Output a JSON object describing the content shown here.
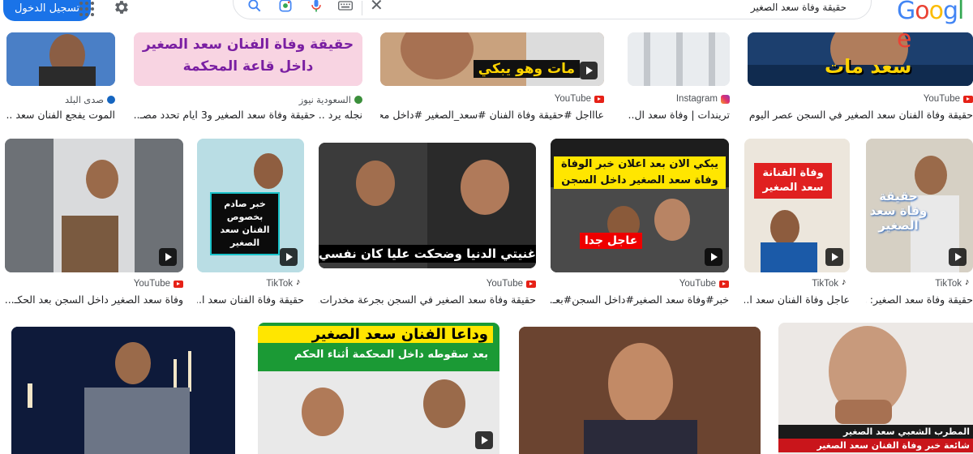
{
  "header": {
    "signin_label": "تسجيل الدخول",
    "search_query": "حقيقة وفاة سعد الصغير",
    "logo": [
      "G",
      "o",
      "o",
      "g",
      "l",
      "e"
    ],
    "logo_colors": [
      "#4285f4",
      "#ea4335",
      "#fbbc05",
      "#4285f4",
      "#34a853",
      "#ea4335"
    ]
  },
  "row1": [
    {
      "source": "YouTube",
      "title": "حقيقة وفاة الفنان سعد الصغير في السجن عصر اليوم ف...",
      "overlay": "سعد مات",
      "icon": "youtube-icon"
    },
    {
      "source": "Instagram",
      "title": "تريندات | وفاة سعد ال...",
      "overlay": "",
      "icon": "instagram-icon"
    },
    {
      "source": "YouTube",
      "title": "عاااجل #حقيقة وفاة الفنان #سعد_الصغير #داخل محب...",
      "overlay": "مات وهو يبكي",
      "icon": "youtube-icon"
    },
    {
      "source": "السعودية نيوز",
      "title": "نجله يرد .. حقيقة وفاة سعد الصغير و3 ايام تحدد مصـ...",
      "overlay": "حقيقة وفاة الفنان سعد الصغير داخل قاعة المحكمة",
      "icon": "site-icon"
    },
    {
      "source": "صدى البلد",
      "title": "الموت يفجع الفنان سعد ...",
      "overlay": "",
      "icon": "site-icon"
    }
  ],
  "row2": [
    {
      "source": "TikTok",
      "title": "حقيقة وفاة سعد الصغير: هل ...",
      "overlay": "حقيقة وفاة سعد الصغير",
      "icon": "tiktok-icon"
    },
    {
      "source": "TikTok",
      "title": "عاجل وفاة الفنان سعد ا...",
      "overlay": "وفاة الفنانة سعد الصغير",
      "icon": "tiktok-icon"
    },
    {
      "source": "YouTube",
      "title": "خبر#وفاة سعد الصغير#داخل السجن#بعـ...",
      "overlay": "يبكي الان بعد اعلان خبر الوفاة وفاة سعد الصغير داخل السجن",
      "overlay2": "عاجل جدا",
      "icon": "youtube-icon"
    },
    {
      "source": "YouTube",
      "title": "حقيقة وفاة سعد الصغير في السجن بجرعة مخدرات...",
      "overlay": "غنيتي الدنيا وضحكت عليا كان نفسي أتوب",
      "icon": "youtube-icon"
    },
    {
      "source": "TikTok",
      "title": "حقيقة وفاة الفنان سعد ا...",
      "overlay": "خبر صادم بخصوص الفنان سعد الصغير",
      "icon": "tiktok-icon"
    },
    {
      "source": "YouTube",
      "title": "وفاة سعد الصغير داخل السجن بعد الحكـ...",
      "overlay": "",
      "icon": "youtube-icon"
    }
  ],
  "row3": [
    {
      "overlay": "المطرب الشعبي سعد الصغير",
      "overlay2": "شائعة خبر وفاة الفنان سعد الصغير",
      "badge": "شائعة"
    },
    {
      "overlay": ""
    },
    {
      "overlay": "وداعا الفنان سعد الصغير",
      "overlay2": "بعد سقوطه داخل المحكمة أثناء الحكم"
    },
    {
      "overlay": ""
    }
  ]
}
